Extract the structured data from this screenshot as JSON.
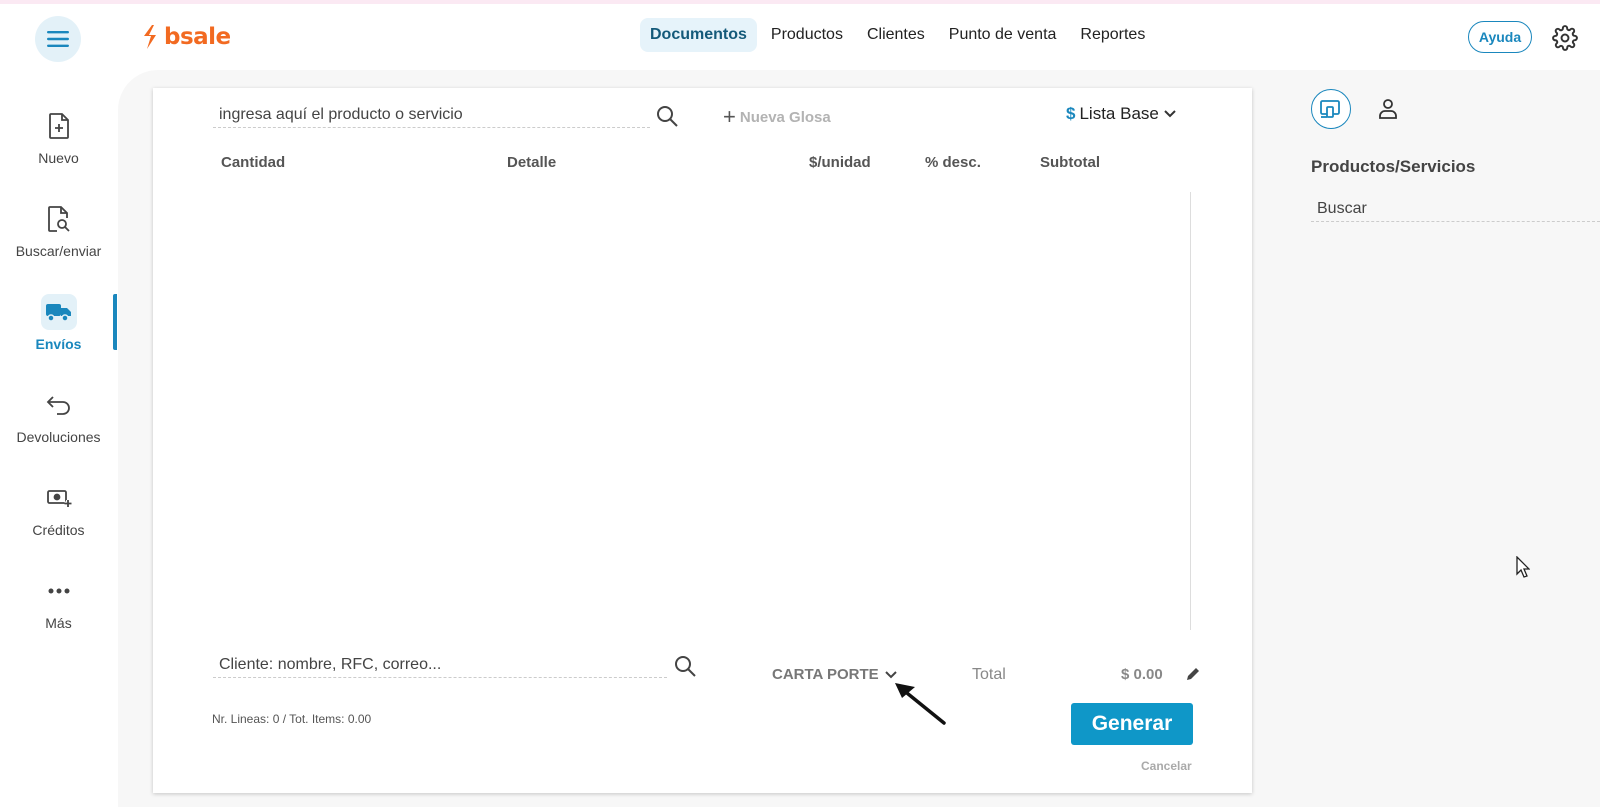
{
  "header": {
    "logo_text": "bsale",
    "nav": [
      {
        "label": "Documentos",
        "active": true
      },
      {
        "label": "Productos",
        "active": false
      },
      {
        "label": "Clientes",
        "active": false
      },
      {
        "label": "Punto de venta",
        "active": false
      },
      {
        "label": "Reportes",
        "active": false
      }
    ],
    "help_label": "Ayuda"
  },
  "sidebar": {
    "items": [
      {
        "label": "Nuevo",
        "icon": "file-plus-icon"
      },
      {
        "label": "Buscar/enviar",
        "icon": "file-search-icon"
      },
      {
        "label": "Envíos",
        "icon": "truck-icon",
        "active": true
      },
      {
        "label": "Devoluciones",
        "icon": "return-arrow-icon"
      },
      {
        "label": "Créditos",
        "icon": "cash-plus-icon"
      },
      {
        "label": "Más",
        "icon": "dots-icon"
      }
    ]
  },
  "document": {
    "product_placeholder": "ingresa aquí el producto o servicio",
    "nueva_glosa": "Nueva Glosa",
    "price_list_symbol": "$",
    "price_list": "Lista Base",
    "columns": [
      "Cantidad",
      "Detalle",
      "$/unidad",
      "% desc.",
      "Subtotal"
    ],
    "client_placeholder": "Cliente: nombre, RFC, correo...",
    "carta_porte": "CARTA PORTE",
    "total_label": "Total",
    "total_value": "$ 0.00",
    "lines_info": "Nr. Lineas: 0 / Tot. Items: 0.00",
    "generate_label": "Generar",
    "cancel_label": "Cancelar"
  },
  "right_panel": {
    "title": "Productos/Servicios",
    "search_placeholder": "Buscar"
  },
  "colors": {
    "brand_orange": "#f26a21",
    "accent_blue": "#1a87bd",
    "button_blue": "#0f97c8"
  }
}
